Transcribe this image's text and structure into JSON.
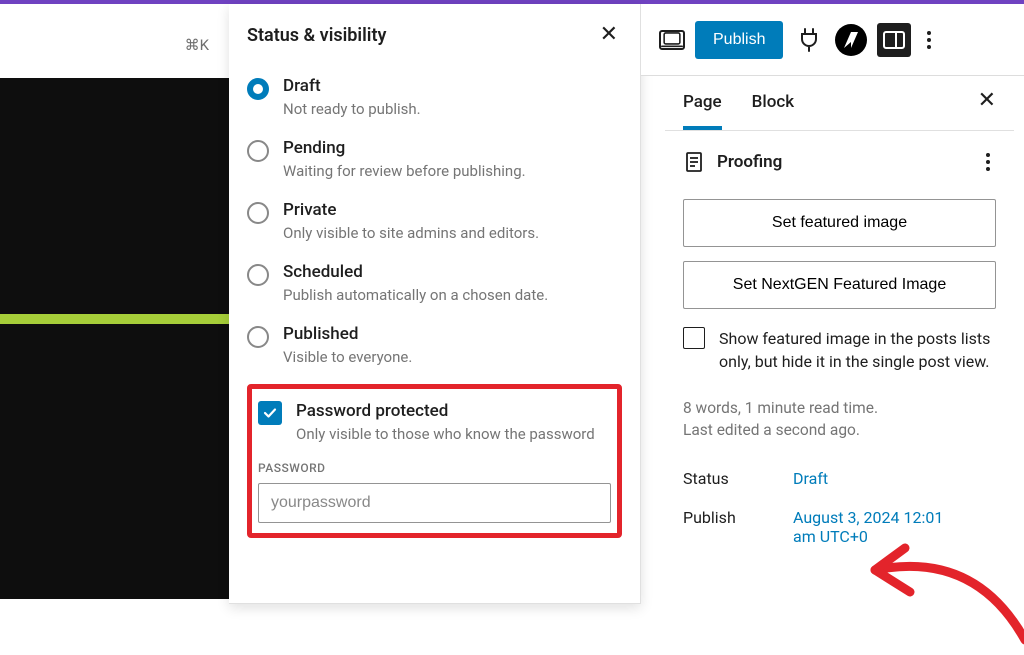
{
  "popover": {
    "title": "Status & visibility",
    "options": [
      {
        "label": "Draft",
        "desc": "Not ready to publish."
      },
      {
        "label": "Pending",
        "desc": "Waiting for review before publishing."
      },
      {
        "label": "Private",
        "desc": "Only visible to site admins and editors."
      },
      {
        "label": "Scheduled",
        "desc": "Publish automatically on a chosen date."
      },
      {
        "label": "Published",
        "desc": "Visible to everyone."
      }
    ],
    "password_protected": {
      "label": "Password protected",
      "desc": "Only visible to those who know the password",
      "field_label": "Password",
      "value": "yourpassword"
    }
  },
  "header": {
    "shortcut": "⌘K",
    "publish": "Publish"
  },
  "sidebar": {
    "tabs": {
      "page": "Page",
      "block": "Block"
    },
    "section_title": "Proofing",
    "featured_btn": "Set featured image",
    "nextgen_btn": "Set NextGEN Featured Image",
    "hide_single": "Show featured image in the posts lists only, but hide it in the single post view.",
    "wordcount": "8 words, 1 minute read time.",
    "last_edited": "Last edited a second ago.",
    "status_key": "Status",
    "status_val": "Draft",
    "publish_key": "Publish",
    "publish_val": "August 3, 2024 12:01 am UTC+0"
  }
}
